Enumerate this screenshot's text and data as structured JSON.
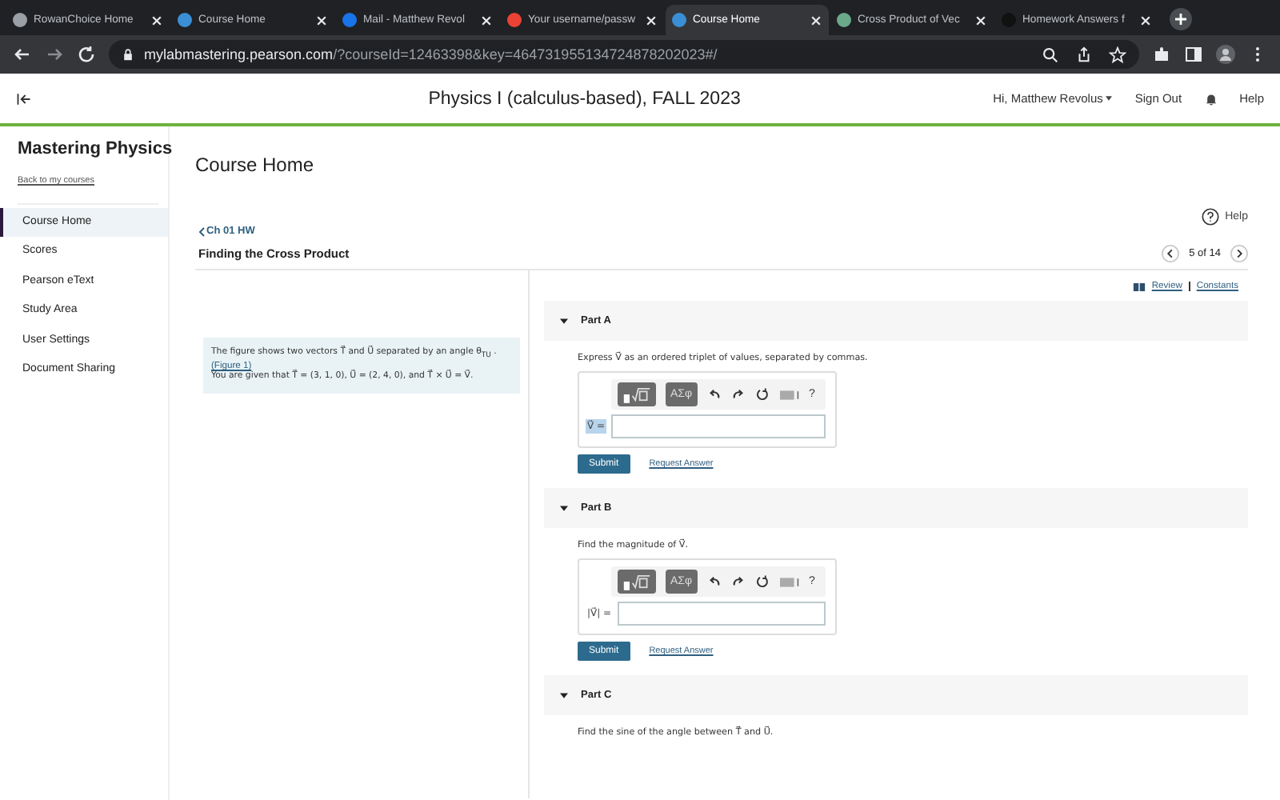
{
  "browser": {
    "tabs": [
      {
        "title": "RowanChoice Home",
        "selected": false,
        "color": "#9aa0a6"
      },
      {
        "title": "Course Home",
        "selected": false,
        "color": "#3a8fd6"
      },
      {
        "title": "Mail - Matthew Revol",
        "selected": false,
        "color": "#1a73e8"
      },
      {
        "title": "Your username/passw",
        "selected": false,
        "color": "#ea4335"
      },
      {
        "title": "Course Home",
        "selected": true,
        "color": "#3a8fd6"
      },
      {
        "title": "Cross Product of Vec",
        "selected": false,
        "color": "#6aa98a"
      },
      {
        "title": "Homework Answers f",
        "selected": false,
        "color": "#111111"
      }
    ],
    "url_host": "mylabmastering.pearson.com",
    "url_path": "/?courseId=12463398&key=464731955134724878202023#/"
  },
  "header": {
    "course_title": "Physics I (calculus-based), FALL 2023",
    "user_menu": "Hi, Matthew Revolus",
    "sign_out": "Sign Out",
    "help": "Help"
  },
  "sidebar": {
    "title": "Mastering Physics",
    "back_link": "Back to my courses",
    "items": [
      {
        "label": "Course Home",
        "selected": true
      },
      {
        "label": "Scores",
        "selected": false
      },
      {
        "label": "Pearson eText",
        "selected": false
      },
      {
        "label": "Study Area",
        "selected": false
      },
      {
        "label": "User Settings",
        "selected": false
      },
      {
        "label": "Document Sharing",
        "selected": false
      }
    ]
  },
  "page_title": "Course Home",
  "help": "Help",
  "breadcrumb": "Ch 01 HW",
  "problem_title": "Finding the Cross Product",
  "pager": "5 of 14",
  "links": [
    "Review",
    "Constants"
  ],
  "intro": {
    "line_1": "The figure shows two vectors T⃗ and U⃗ separated by an angle θ$_{TU}$ .",
    "figure_link": "(Figure 1)",
    "line_2": "You are given that T⃗ = (3, 1, 0), U⃗ = (2, 4, 0), and T⃗ × U⃗ = V⃗."
  },
  "parts": [
    {
      "title": "Part A",
      "expanded": true,
      "prompt": "Express V⃗ as an ordered triplet of values, separated by commas.",
      "answer": {
        "symbols": "ΑΣφ",
        "help": "?",
        "label": "V⃗ =",
        "label_selected": true,
        "submit": "Submit",
        "request": "Request Answer"
      }
    },
    {
      "title": "Part B",
      "expanded": true,
      "prompt": "Find the magnitude of V⃗.",
      "answer": {
        "symbols": "ΑΣφ",
        "help": "?",
        "label": "|V⃗| =",
        "label_selected": false,
        "submit": "Submit",
        "request": "Request Answer"
      }
    },
    {
      "title": "Part C",
      "expanded": true,
      "prompt": "Find the sine of the angle between T⃗ and U⃗."
    }
  ]
}
